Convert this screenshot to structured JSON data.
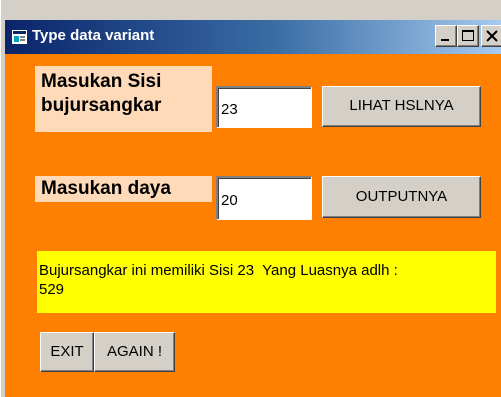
{
  "window": {
    "title": "Type data variant",
    "controls": {
      "minimize_icon": "minimize-icon",
      "maximize_icon": "maximize-icon",
      "close_icon": "close-icon"
    }
  },
  "form": {
    "sisi_label_line1": "Masukan Sisi",
    "sisi_label_line2": "bujursangkar",
    "sisi_value": "23",
    "lihat_button": "LIHAT HSLNYA",
    "daya_label": "Masukan daya",
    "daya_value": "20",
    "output_button": "OUTPUTNYA",
    "result_line1": "Bujursangkar ini memiliki Sisi 23  Yang Luasnya adlh :",
    "result_line2": "529",
    "exit_button": "EXIT",
    "again_button": "AGAIN !"
  },
  "colors": {
    "form_background": "#ff8000",
    "label_background": "#ffdab9",
    "result_background": "#ffff00",
    "titlebar_start": "#0a246a",
    "titlebar_end": "#a6caf0"
  }
}
